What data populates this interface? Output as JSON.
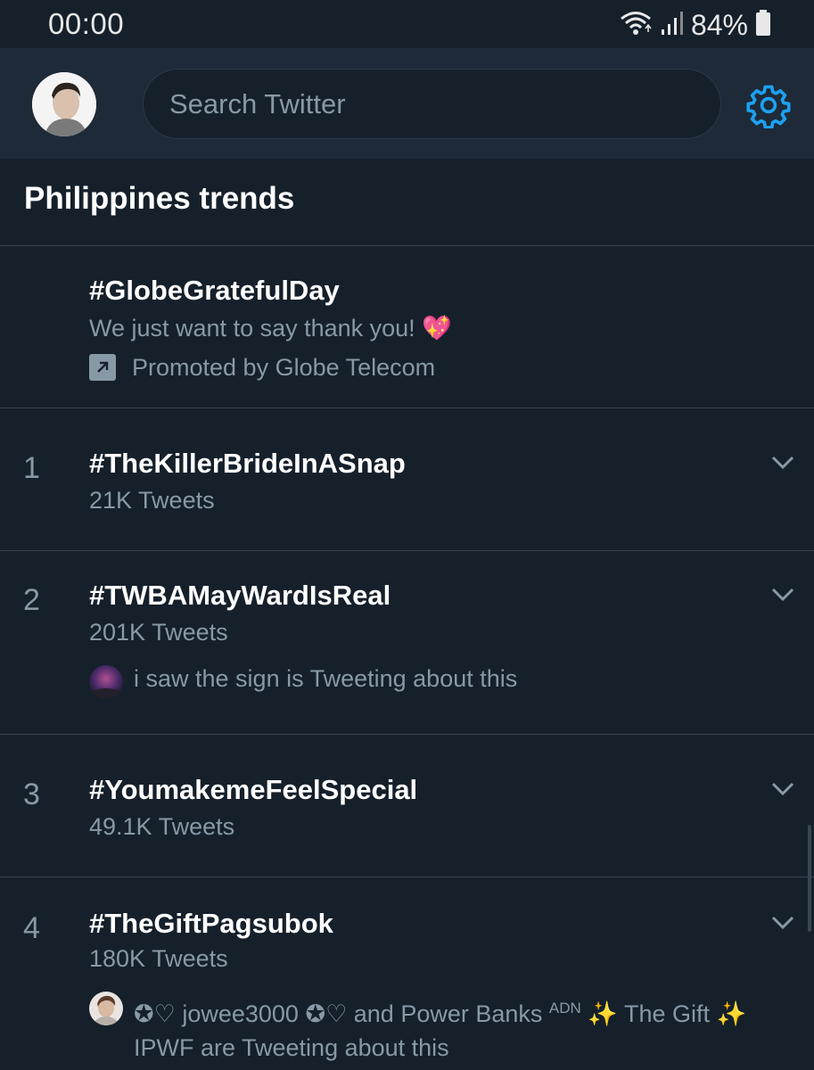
{
  "status_bar": {
    "time": "00:00",
    "battery": "84%",
    "icons": [
      "wifi-icon",
      "signal-icon",
      "battery-icon"
    ]
  },
  "header": {
    "search_placeholder": "Search Twitter",
    "icons": [
      "avatar",
      "settings-gear-icon"
    ]
  },
  "section_title": "Philippines trends",
  "promoted": {
    "hashtag": "#GlobeGratefulDay",
    "description": "We just want to say thank you!",
    "emoji": "💖",
    "promoted_by": "Promoted by Globe Telecom"
  },
  "trends": [
    {
      "rank": "1",
      "hashtag": "#TheKillerBrideInASnap",
      "tweets": "21K Tweets"
    },
    {
      "rank": "2",
      "hashtag": "#TWBAMayWardIsReal",
      "tweets": "201K Tweets",
      "context": "i saw the sign is Tweeting about this"
    },
    {
      "rank": "3",
      "hashtag": "#YoumakemeFeelSpecial",
      "tweets": "49.1K Tweets"
    },
    {
      "rank": "4",
      "hashtag": "#TheGiftPagsubok",
      "tweets": "180K Tweets",
      "context_part1": "✪♡ jowee3000 ✪♡ and Power Banks",
      "context_sup": "ADN",
      "context_part2": "✨ The Gift ✨",
      "context_line2": "IPWF are Tweeting about this"
    }
  ],
  "colors": {
    "background": "#15202b",
    "header": "#1e2a38",
    "accent": "#1da1f2",
    "secondary_text": "#8899a6",
    "divider": "#38444d"
  }
}
